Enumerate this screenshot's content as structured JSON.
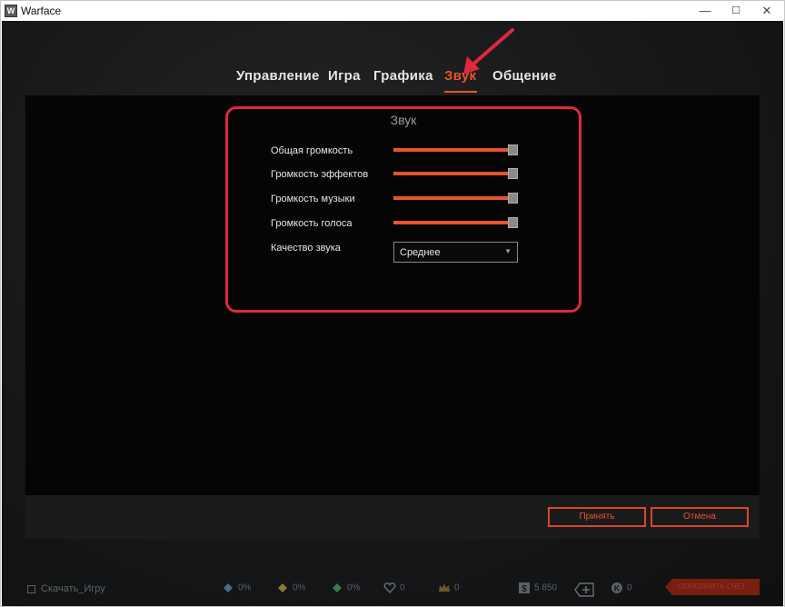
{
  "window": {
    "title": "Warface",
    "icon_label": "W",
    "controls": {
      "minimize": "—",
      "maximize": "☐",
      "close": "✕"
    }
  },
  "tabs": [
    {
      "label": "Управление",
      "active": false
    },
    {
      "label": "Игра",
      "active": false
    },
    {
      "label": "Графика",
      "active": false
    },
    {
      "label": "Звук",
      "active": true
    },
    {
      "label": "Общение",
      "active": false
    }
  ],
  "sound": {
    "title": "Звук",
    "sliders": [
      {
        "label": "Общая громкость",
        "value": 1.0
      },
      {
        "label": "Громкость эффектов",
        "value": 1.0
      },
      {
        "label": "Громкость музыки",
        "value": 1.0
      },
      {
        "label": "Громкость голоса",
        "value": 1.0
      }
    ],
    "quality": {
      "label": "Качество звука",
      "value": "Среднее"
    }
  },
  "buttons": {
    "accept": "Принять",
    "cancel": "Отмена"
  },
  "statusbar": {
    "download": "Скачать_Игру",
    "items": [
      {
        "icon": "boost-xp-icon",
        "text": "0%"
      },
      {
        "icon": "boost-money-icon",
        "text": "0%"
      },
      {
        "icon": "boost-vp-icon",
        "text": "0%"
      },
      {
        "icon": "heart-icon",
        "text": "0"
      },
      {
        "icon": "crown-icon",
        "text": "0"
      },
      {
        "icon": "dollar-icon",
        "text": "5 850"
      },
      {
        "icon": "plus-icon",
        "text": ""
      },
      {
        "icon": "k-credits-icon",
        "text": "0"
      }
    ],
    "topup": "ПОПОЛНИТЬ СЧЕТ"
  },
  "colors": {
    "accent": "#e8542a",
    "highlight": "#e0283c",
    "background": "#141516"
  }
}
